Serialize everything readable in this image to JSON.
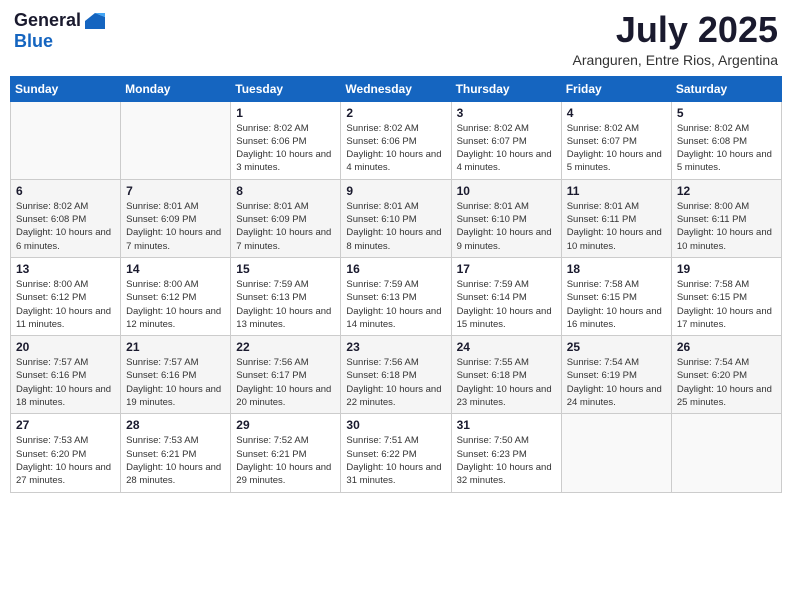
{
  "header": {
    "logo": {
      "general": "General",
      "blue": "Blue"
    },
    "title": "July 2025",
    "location": "Aranguren, Entre Rios, Argentina"
  },
  "calendar": {
    "weekdays": [
      "Sunday",
      "Monday",
      "Tuesday",
      "Wednesday",
      "Thursday",
      "Friday",
      "Saturday"
    ],
    "weeks": [
      [
        {
          "day": "",
          "info": ""
        },
        {
          "day": "",
          "info": ""
        },
        {
          "day": "1",
          "info": "Sunrise: 8:02 AM\nSunset: 6:06 PM\nDaylight: 10 hours and 3 minutes."
        },
        {
          "day": "2",
          "info": "Sunrise: 8:02 AM\nSunset: 6:06 PM\nDaylight: 10 hours and 4 minutes."
        },
        {
          "day": "3",
          "info": "Sunrise: 8:02 AM\nSunset: 6:07 PM\nDaylight: 10 hours and 4 minutes."
        },
        {
          "day": "4",
          "info": "Sunrise: 8:02 AM\nSunset: 6:07 PM\nDaylight: 10 hours and 5 minutes."
        },
        {
          "day": "5",
          "info": "Sunrise: 8:02 AM\nSunset: 6:08 PM\nDaylight: 10 hours and 5 minutes."
        }
      ],
      [
        {
          "day": "6",
          "info": "Sunrise: 8:02 AM\nSunset: 6:08 PM\nDaylight: 10 hours and 6 minutes."
        },
        {
          "day": "7",
          "info": "Sunrise: 8:01 AM\nSunset: 6:09 PM\nDaylight: 10 hours and 7 minutes."
        },
        {
          "day": "8",
          "info": "Sunrise: 8:01 AM\nSunset: 6:09 PM\nDaylight: 10 hours and 7 minutes."
        },
        {
          "day": "9",
          "info": "Sunrise: 8:01 AM\nSunset: 6:10 PM\nDaylight: 10 hours and 8 minutes."
        },
        {
          "day": "10",
          "info": "Sunrise: 8:01 AM\nSunset: 6:10 PM\nDaylight: 10 hours and 9 minutes."
        },
        {
          "day": "11",
          "info": "Sunrise: 8:01 AM\nSunset: 6:11 PM\nDaylight: 10 hours and 10 minutes."
        },
        {
          "day": "12",
          "info": "Sunrise: 8:00 AM\nSunset: 6:11 PM\nDaylight: 10 hours and 10 minutes."
        }
      ],
      [
        {
          "day": "13",
          "info": "Sunrise: 8:00 AM\nSunset: 6:12 PM\nDaylight: 10 hours and 11 minutes."
        },
        {
          "day": "14",
          "info": "Sunrise: 8:00 AM\nSunset: 6:12 PM\nDaylight: 10 hours and 12 minutes."
        },
        {
          "day": "15",
          "info": "Sunrise: 7:59 AM\nSunset: 6:13 PM\nDaylight: 10 hours and 13 minutes."
        },
        {
          "day": "16",
          "info": "Sunrise: 7:59 AM\nSunset: 6:13 PM\nDaylight: 10 hours and 14 minutes."
        },
        {
          "day": "17",
          "info": "Sunrise: 7:59 AM\nSunset: 6:14 PM\nDaylight: 10 hours and 15 minutes."
        },
        {
          "day": "18",
          "info": "Sunrise: 7:58 AM\nSunset: 6:15 PM\nDaylight: 10 hours and 16 minutes."
        },
        {
          "day": "19",
          "info": "Sunrise: 7:58 AM\nSunset: 6:15 PM\nDaylight: 10 hours and 17 minutes."
        }
      ],
      [
        {
          "day": "20",
          "info": "Sunrise: 7:57 AM\nSunset: 6:16 PM\nDaylight: 10 hours and 18 minutes."
        },
        {
          "day": "21",
          "info": "Sunrise: 7:57 AM\nSunset: 6:16 PM\nDaylight: 10 hours and 19 minutes."
        },
        {
          "day": "22",
          "info": "Sunrise: 7:56 AM\nSunset: 6:17 PM\nDaylight: 10 hours and 20 minutes."
        },
        {
          "day": "23",
          "info": "Sunrise: 7:56 AM\nSunset: 6:18 PM\nDaylight: 10 hours and 22 minutes."
        },
        {
          "day": "24",
          "info": "Sunrise: 7:55 AM\nSunset: 6:18 PM\nDaylight: 10 hours and 23 minutes."
        },
        {
          "day": "25",
          "info": "Sunrise: 7:54 AM\nSunset: 6:19 PM\nDaylight: 10 hours and 24 minutes."
        },
        {
          "day": "26",
          "info": "Sunrise: 7:54 AM\nSunset: 6:20 PM\nDaylight: 10 hours and 25 minutes."
        }
      ],
      [
        {
          "day": "27",
          "info": "Sunrise: 7:53 AM\nSunset: 6:20 PM\nDaylight: 10 hours and 27 minutes."
        },
        {
          "day": "28",
          "info": "Sunrise: 7:53 AM\nSunset: 6:21 PM\nDaylight: 10 hours and 28 minutes."
        },
        {
          "day": "29",
          "info": "Sunrise: 7:52 AM\nSunset: 6:21 PM\nDaylight: 10 hours and 29 minutes."
        },
        {
          "day": "30",
          "info": "Sunrise: 7:51 AM\nSunset: 6:22 PM\nDaylight: 10 hours and 31 minutes."
        },
        {
          "day": "31",
          "info": "Sunrise: 7:50 AM\nSunset: 6:23 PM\nDaylight: 10 hours and 32 minutes."
        },
        {
          "day": "",
          "info": ""
        },
        {
          "day": "",
          "info": ""
        }
      ]
    ]
  }
}
